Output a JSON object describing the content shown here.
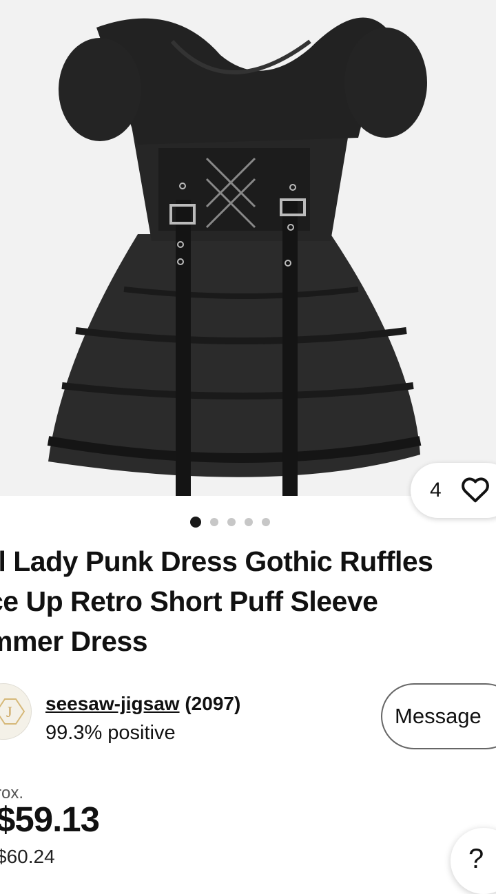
{
  "gallery": {
    "favorite_count": "4",
    "image_count": 5,
    "active_index": 0,
    "image_alt": "black gothic ruffled lace-up dress"
  },
  "listing": {
    "title_lines": [
      "rl Lady Punk Dress Gothic Ruffles",
      "ce Up Retro Short Puff Sleeve",
      "mmer Dress"
    ]
  },
  "seller": {
    "name": "seesaw-jigsaw",
    "score": "(2097)",
    "feedback": "99.3% positive",
    "avatar_letter": "J"
  },
  "actions": {
    "message_label": "Message",
    "help_label": "?"
  },
  "price": {
    "approx_label": "rox.",
    "current": "$59.13",
    "original": "$60.24"
  }
}
